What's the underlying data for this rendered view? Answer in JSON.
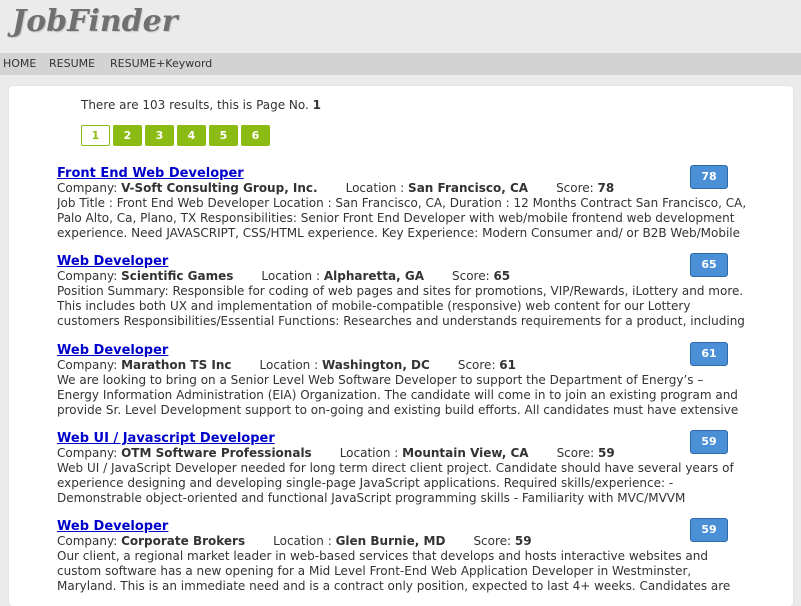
{
  "app": {
    "logo": "JobFinder"
  },
  "nav": {
    "items": [
      "HOME",
      "RESUME",
      "RESUME+Keyword"
    ]
  },
  "results": {
    "summary_prefix": "There are 103 results, this is Page No. ",
    "page_number": "1"
  },
  "pager": {
    "pages": [
      "1",
      "2",
      "3",
      "4",
      "5",
      "6"
    ],
    "current": "1"
  },
  "labels": {
    "company": "Company: ",
    "location": "Location : ",
    "score": "Score: "
  },
  "jobs": [
    {
      "title": "Front End Web Developer",
      "company": "V-Soft Consulting Group, Inc.",
      "location": "San Francisco, CA",
      "score": "78",
      "description": "Job Title : Front End Web Developer Location : San Francisco, CA, Duration : 12 Months Contract San Francisco, CA, Palo Alto, Ca, Plano, TX Responsibilities: Senior Front End Developer with web/mobile frontend web development experience. Need JAVASCRIPT, CSS/HTML experience. Key Experience: Modern Consumer and/ or B2B Web/Mobile"
    },
    {
      "title": "Web Developer",
      "company": "Scientific Games",
      "location": "Alpharetta, GA",
      "score": "65",
      "description": "Position Summary: Responsible for coding of web pages and sites for promotions, VIP/Rewards, iLottery and more. This includes both UX and implementation of mobile-compatible (responsive) web content for our Lottery customers Responsibilities/Essential Functions: Researches and understands requirements for a product, including target"
    },
    {
      "title": "Web Developer",
      "company": "Marathon TS Inc",
      "location": "Washington, DC",
      "score": "61",
      "description": "We are looking to bring on a Senior Level Web Software Developer to support the Department of Energy’s – Energy Information Administration (EIA) Organization. The candidate will come in to join an existing program and provide Sr. Level Development support to on-going and existing build efforts. All candidates must have extensive experience in the"
    },
    {
      "title": "Web UI / Javascript Developer",
      "company": "OTM Software Professionals",
      "location": "Mountain View, CA",
      "score": "59",
      "description": "Web UI / JavaScript Developer needed for long term direct client project. Candidate should have several years of experience designing and developing single-page JavaScript applications.   Required skills/experience: - Demonstrable object-oriented and functional JavaScript programming skills - Familiarity with MVC/MVVM Javascript frameworks -"
    },
    {
      "title": "Web Developer",
      "company": "Corporate Brokers",
      "location": "Glen Burnie, MD",
      "score": "59",
      "description": "Our client, a regional market leader in web-based services that develops and hosts interactive websites and custom software has a new opening for a Mid Level Front-End Web Application Developer in Westminster, Maryland. This is an immediate need and is a contract only position, expected to last 4+ weeks. Candidates are required to sit on-site in"
    }
  ]
}
